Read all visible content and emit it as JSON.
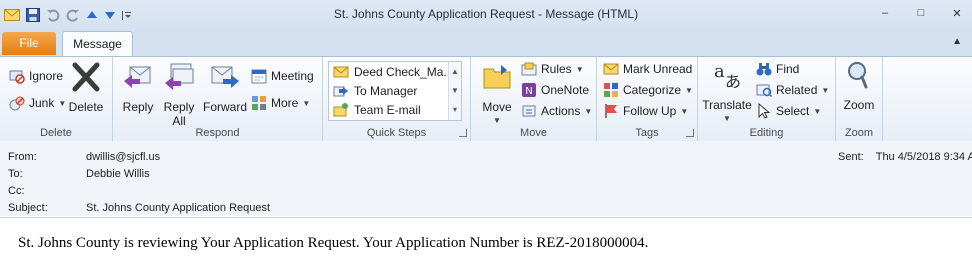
{
  "window": {
    "title": "St. Johns County Application Request  -  Message (HTML)",
    "minimize_glyph": "–",
    "maximize_glyph": "□",
    "close_glyph": "✕"
  },
  "tabs": [
    {
      "label": "File"
    },
    {
      "label": "Message"
    }
  ],
  "ribbon": {
    "delete": {
      "label": "Delete",
      "ignore": "Ignore",
      "junk": "Junk",
      "delete": "Delete"
    },
    "respond": {
      "label": "Respond",
      "reply": "Reply",
      "reply_all_1": "Reply",
      "reply_all_2": "All",
      "forward": "Forward",
      "meeting": "Meeting",
      "more": "More"
    },
    "quick_steps": {
      "label": "Quick Steps",
      "items": [
        "Deed Check_Ma...",
        "To Manager",
        "Team E-mail"
      ]
    },
    "move": {
      "label": "Move",
      "move": "Move",
      "rules": "Rules",
      "onenote": "OneNote",
      "actions": "Actions"
    },
    "tags": {
      "label": "Tags",
      "mark_unread": "Mark Unread",
      "categorize": "Categorize",
      "follow_up": "Follow Up"
    },
    "editing": {
      "label": "Editing",
      "translate": "Translate",
      "find": "Find",
      "related": "Related",
      "select": "Select"
    },
    "zoom": {
      "label": "Zoom",
      "zoom": "Zoom"
    }
  },
  "message": {
    "from_label": "From:",
    "from": "dwillis@sjcfl.us",
    "to_label": "To:",
    "to": "Debbie Willis",
    "cc_label": "Cc:",
    "cc": "",
    "subject_label": "Subject:",
    "subject": "St. Johns County Application Request",
    "sent_label": "Sent:",
    "sent": "Thu 4/5/2018 9:34 A",
    "body": "St. Johns County is reviewing Your Application Request. Your Application Number is REZ-2018000004."
  },
  "colors": {
    "file_tab": "#e57d12",
    "accent": "#2b5797",
    "ribbon_bg": "#e7eef7"
  },
  "icons": [
    "envelope-icon",
    "save-icon",
    "undo-icon",
    "redo-icon",
    "up-arrow-icon",
    "down-arrow-icon",
    "customize-icon"
  ]
}
